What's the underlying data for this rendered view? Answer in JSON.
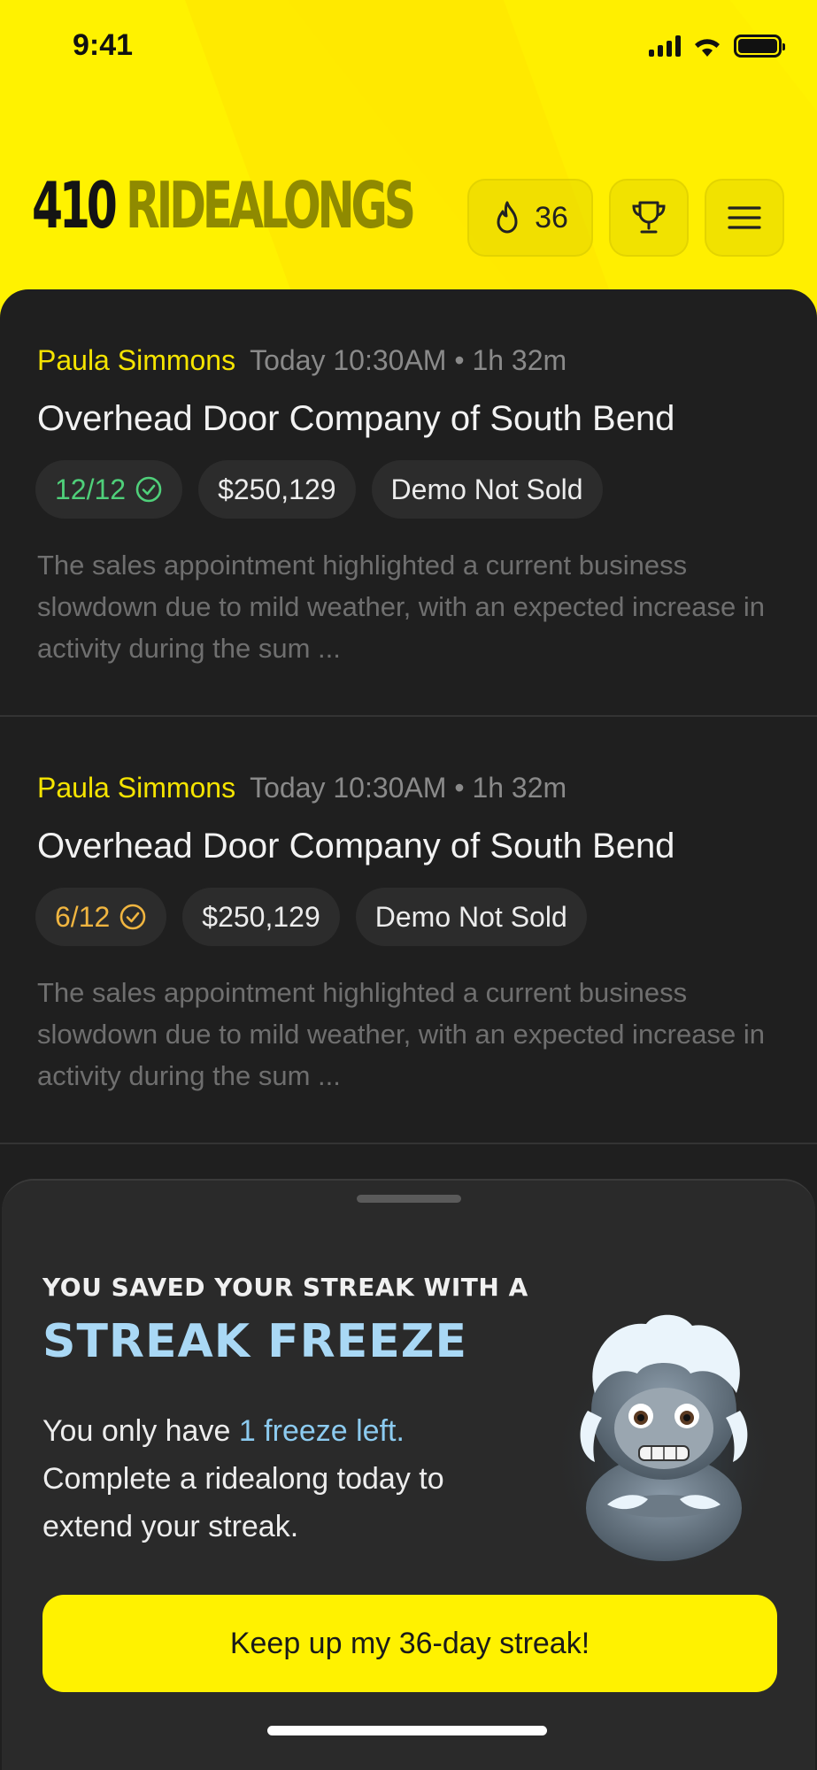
{
  "status": {
    "time": "9:41"
  },
  "header": {
    "brand_number": "410",
    "brand_word": "RIDEALONGS",
    "streak_count": "36",
    "icons": {
      "streak": "flame-icon",
      "trophy": "trophy-icon",
      "menu": "hamburger-menu-icon"
    }
  },
  "ridealongs": [
    {
      "rep": "Paula Simmons",
      "when": "Today 10:30AM • 1h 32m",
      "company": "Overhead Door Company of South Bend",
      "score": "12/12",
      "score_status": "complete",
      "score_color": "#4fd07a",
      "amount": "$250,129",
      "outcome": "Demo Not Sold",
      "summary": "The sales appointment highlighted a current business slowdown due to mild weather, with an expected increase in activity during the sum ..."
    },
    {
      "rep": "Paula Simmons",
      "when": "Today 10:30AM • 1h 32m",
      "company": "Overhead Door Company of South Bend",
      "score": "6/12",
      "score_status": "partial",
      "score_color": "#f0b540",
      "amount": "$250,129",
      "outcome": "Demo Not Sold",
      "summary": "The sales appointment highlighted a current business slowdown due to mild weather, with an expected increase in activity during the sum ..."
    }
  ],
  "sheet": {
    "kicker": "YOU SAVED YOUR STREAK WITH A",
    "headline": "STREAK FREEZE",
    "body_prefix": "You only have ",
    "body_highlight": "1 freeze left.",
    "body_suffix": " Complete a ridealong today to extend your streak.",
    "mascot_icon": "frozen-yeti-mascot-icon",
    "cta_label": "Keep up my 36-day streak!"
  },
  "colors": {
    "accent_yellow": "#fff200",
    "freeze_blue": "#a9d8f5",
    "rep_name": "#f5e400"
  }
}
